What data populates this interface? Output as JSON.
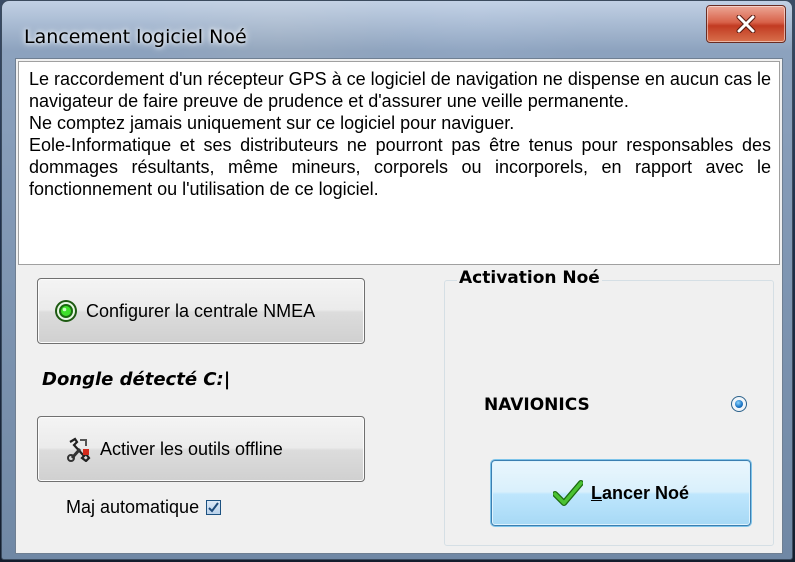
{
  "window": {
    "title": "Lancement logiciel Noé"
  },
  "disclaimer": {
    "paragraphs": [
      "Le  raccordement d'un récepteur GPS à ce logiciel de navigation ne dispense en  aucun  cas  le  navigateur de faire preuve de prudence et d'assurer une veille permanente.",
      "Ne comptez jamais uniquement sur ce logiciel pour naviguer.",
      "Eole-Informatique et ses distributeurs ne pourront pas être tenus pour responsables  des  dommages  résultants,  même mineurs,  corporels  ou incorporels,  en rapport  avec le fonctionnement ou l'utilisation de ce logiciel."
    ]
  },
  "buttons": {
    "configure_nmea": "Configurer la centrale NMEA",
    "offline_tools": "Activer les outils offline",
    "launch_mnemonic": "L",
    "launch_rest": "ancer Noé"
  },
  "dongle": {
    "label": "Dongle détecté C:|"
  },
  "auto_update": {
    "label": "Maj automatique",
    "checked": true
  },
  "activation": {
    "legend": "Activation Noé",
    "options": [
      {
        "label": "NAVIONICS",
        "selected": true
      }
    ]
  },
  "colors": {
    "nmea_indicator": "#2ecc1a",
    "launch_check": "#2a9a1c",
    "close_button": "#c8452c"
  },
  "icons": {
    "close": "close-icon",
    "nmea": "green-status-icon",
    "offline": "tools-icon",
    "launch": "checkmark-icon"
  }
}
